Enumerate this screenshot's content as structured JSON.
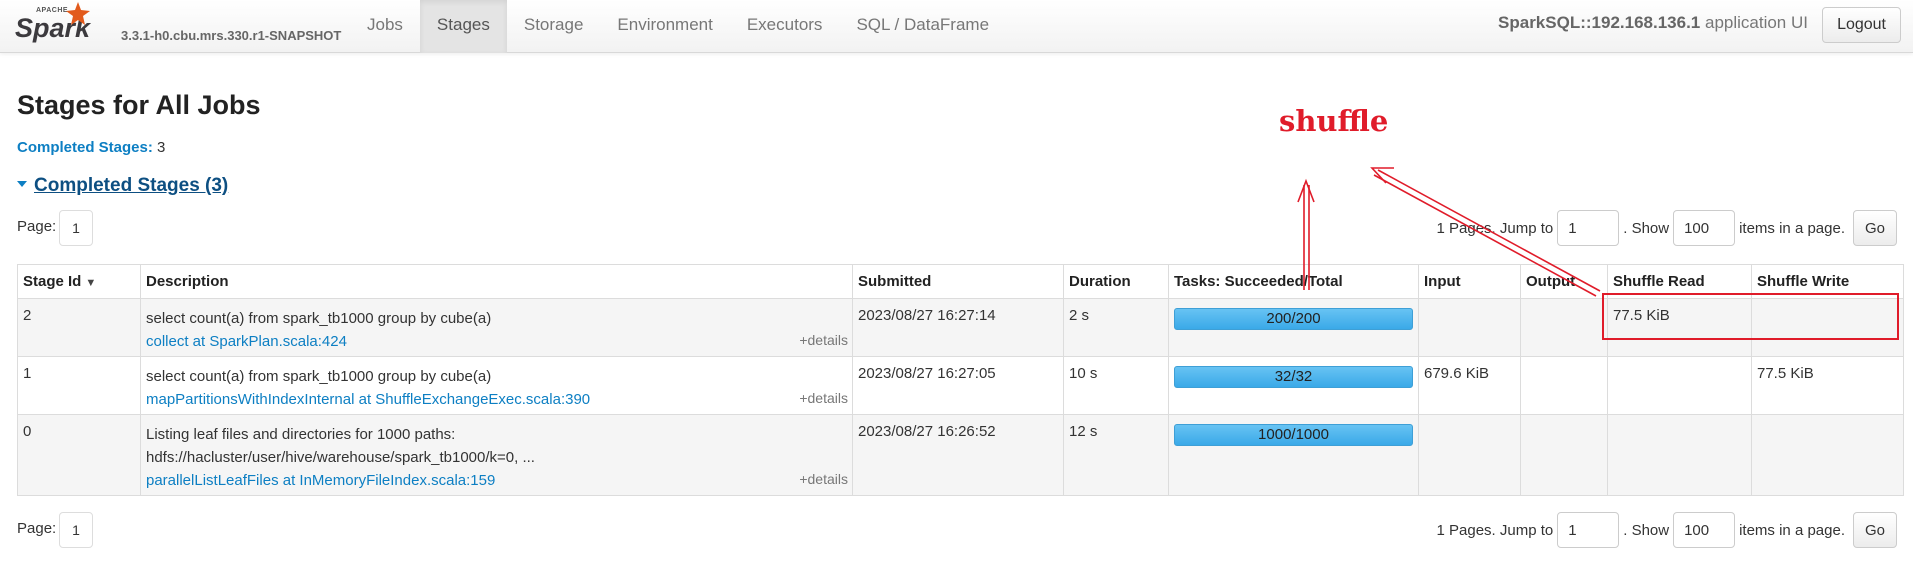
{
  "navbar": {
    "brand_version": "3.3.1-h0.cbu.mrs.330.r1-SNAPSHOT",
    "tabs": [
      "Jobs",
      "Stages",
      "Storage",
      "Environment",
      "Executors",
      "SQL / DataFrame"
    ],
    "active_tab": "Stages",
    "app_name": "SparkSQL::192.168.136.1",
    "app_suffix": "application UI",
    "logout_label": "Logout"
  },
  "page": {
    "title": "Stages for All Jobs",
    "summary_label": "Completed Stages:",
    "summary_value": "3",
    "section_title": "Completed Stages (3)"
  },
  "pager": {
    "page_label": "Page:",
    "current_page": "1",
    "pages_text": "1 Pages. Jump to",
    "jump_value": "1",
    "show_text": ". Show",
    "show_value": "100",
    "items_text": "items in a page.",
    "go_label": "Go"
  },
  "table": {
    "headers": [
      "Stage Id",
      "Description",
      "Submitted",
      "Duration",
      "Tasks: Succeeded/Total",
      "Input",
      "Output",
      "Shuffle Read",
      "Shuffle Write"
    ],
    "sort_indicator": "▼",
    "details_label": "+details",
    "rows": [
      {
        "stage_id": "2",
        "description_lines": [
          "select count(a) from spark_tb1000 group by cube(a)"
        ],
        "link": "collect at SparkPlan.scala:424",
        "submitted": "2023/08/27 16:27:14",
        "duration": "2 s",
        "tasks": "200/200",
        "tasks_fraction": 1.0,
        "input": "",
        "output": "",
        "shuffle_read": "77.5 KiB",
        "shuffle_write": ""
      },
      {
        "stage_id": "1",
        "description_lines": [
          "select count(a) from spark_tb1000 group by cube(a)"
        ],
        "link": "mapPartitionsWithIndexInternal at ShuffleExchangeExec.scala:390",
        "submitted": "2023/08/27 16:27:05",
        "duration": "10 s",
        "tasks": "32/32",
        "tasks_fraction": 1.0,
        "input": "679.6 KiB",
        "output": "",
        "shuffle_read": "",
        "shuffle_write": "77.5 KiB"
      },
      {
        "stage_id": "0",
        "description_lines": [
          "Listing leaf files and directories for 1000 paths:",
          "hdfs://hacluster/user/hive/warehouse/spark_tb1000/k=0, ..."
        ],
        "link": "parallelListLeafFiles at InMemoryFileIndex.scala:159",
        "submitted": "2023/08/27 16:26:52",
        "duration": "12 s",
        "tasks": "1000/1000",
        "tasks_fraction": 1.0,
        "input": "",
        "output": "",
        "shuffle_read": "",
        "shuffle_write": ""
      }
    ]
  },
  "annotation": {
    "label": "shuffle",
    "color": "#e01c2a"
  },
  "colors": {
    "link": "#0d7fc3",
    "progress_bar": "#4db5ee",
    "stripe": "#f5f5f5"
  }
}
